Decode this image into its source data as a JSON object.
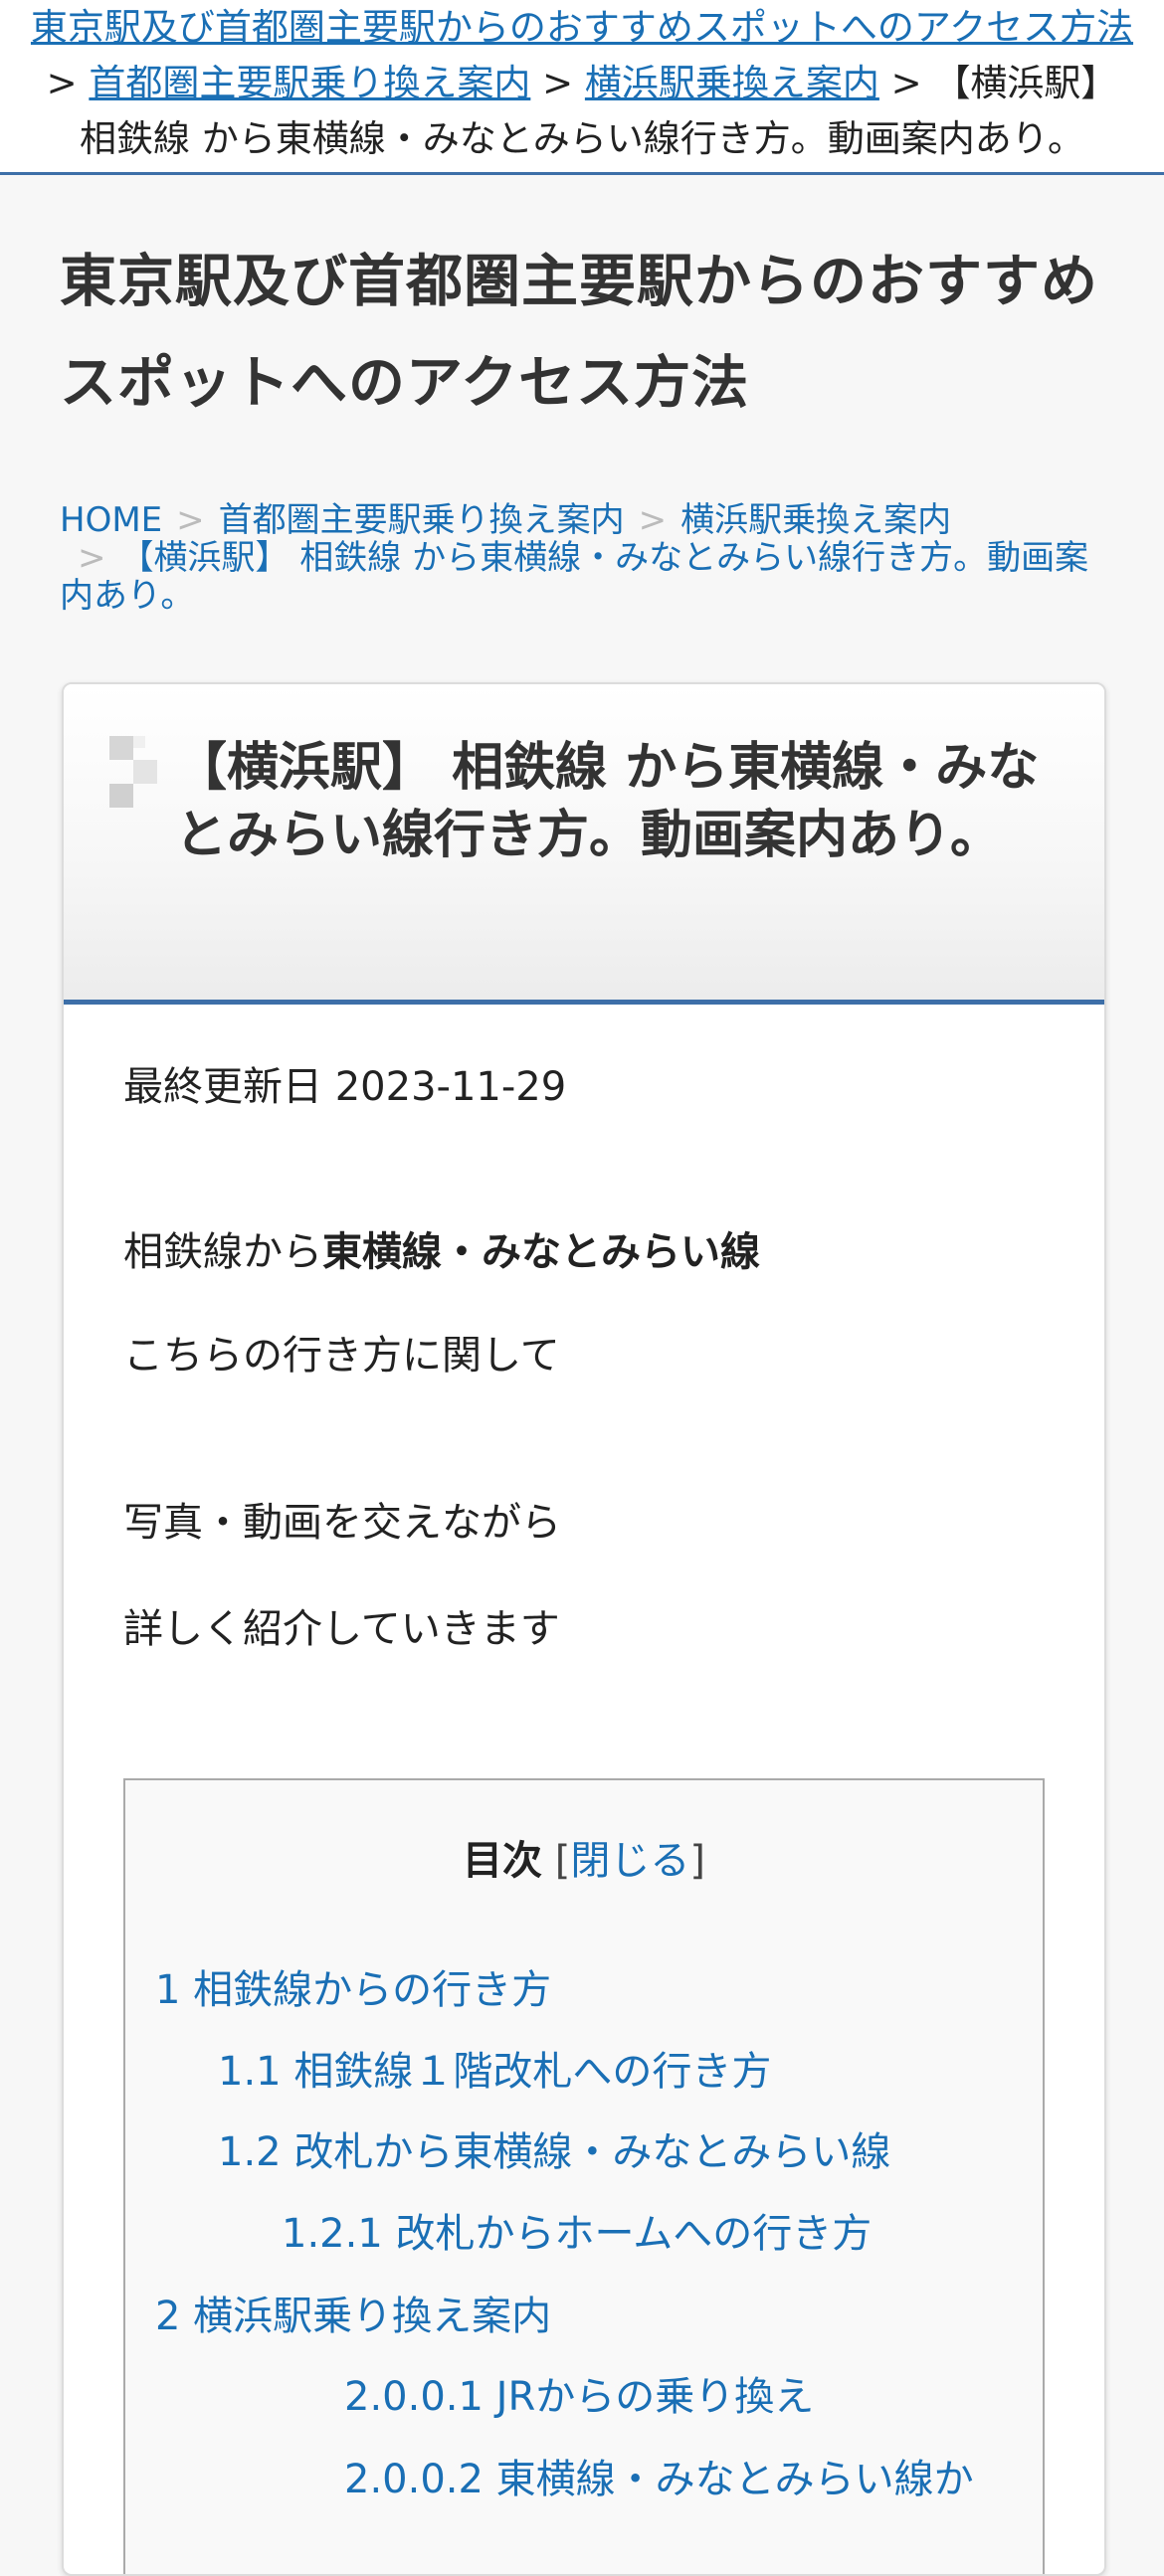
{
  "topbar": {
    "site_link": "東京駅及び首都圏主要駅からのおすすめスポットへのアクセス方法",
    "sep": ">",
    "crumb1": "首都圏主要駅乗り換え案内",
    "crumb2": "横浜駅乗換え案内",
    "crumb3_a": "【横浜駅】",
    "crumb3_b": "相鉄線 から東横線・みなとみらい線行き方。動画案内あり。"
  },
  "site_title": "東京駅及び首都圏主要駅からのおすすめスポットへのアクセス方法",
  "breadcrumb": {
    "home": "HOME",
    "sep": ">",
    "item1": "首都圏主要駅乗り換え案内",
    "item2": "横浜駅乗換え案内",
    "item3": "【横浜駅】 相鉄線 から東横線・みなとみらい線行き方。動画案内あり。"
  },
  "article": {
    "title": "【横浜駅】 相鉄線 から東横線・みなとみらい線行き方。動画案内あり。",
    "updated_label": "最終更新日",
    "updated_date": "2023-11-29",
    "intro_prefix": "相鉄線から",
    "intro_bold": "東横線・みなとみらい線",
    "line2": "こちらの行き方に関して",
    "line3": "写真・動画を交えながら",
    "line4": "詳しく紹介していきます"
  },
  "toc": {
    "title": "目次",
    "bracket_open": "[",
    "toggle": "閉じる",
    "bracket_close": "]",
    "items": [
      {
        "label": "1 相鉄線からの行き方"
      },
      {
        "label": "1.1 相鉄線１階改札への行き方"
      },
      {
        "label": "1.2 改札から東横線・みなとみらい線"
      },
      {
        "label": "1.2.1 改札からホームへの行き方"
      },
      {
        "label": "2 横浜駅乗り換え案内"
      },
      {
        "label": "2.0.0.1 JRからの乗り換え"
      },
      {
        "label": "2.0.0.2 東横線・みなとみらい線か"
      }
    ]
  },
  "colors": {
    "link": "#1a6fb5",
    "accent_border": "#3d6fa8",
    "text": "#222222"
  }
}
